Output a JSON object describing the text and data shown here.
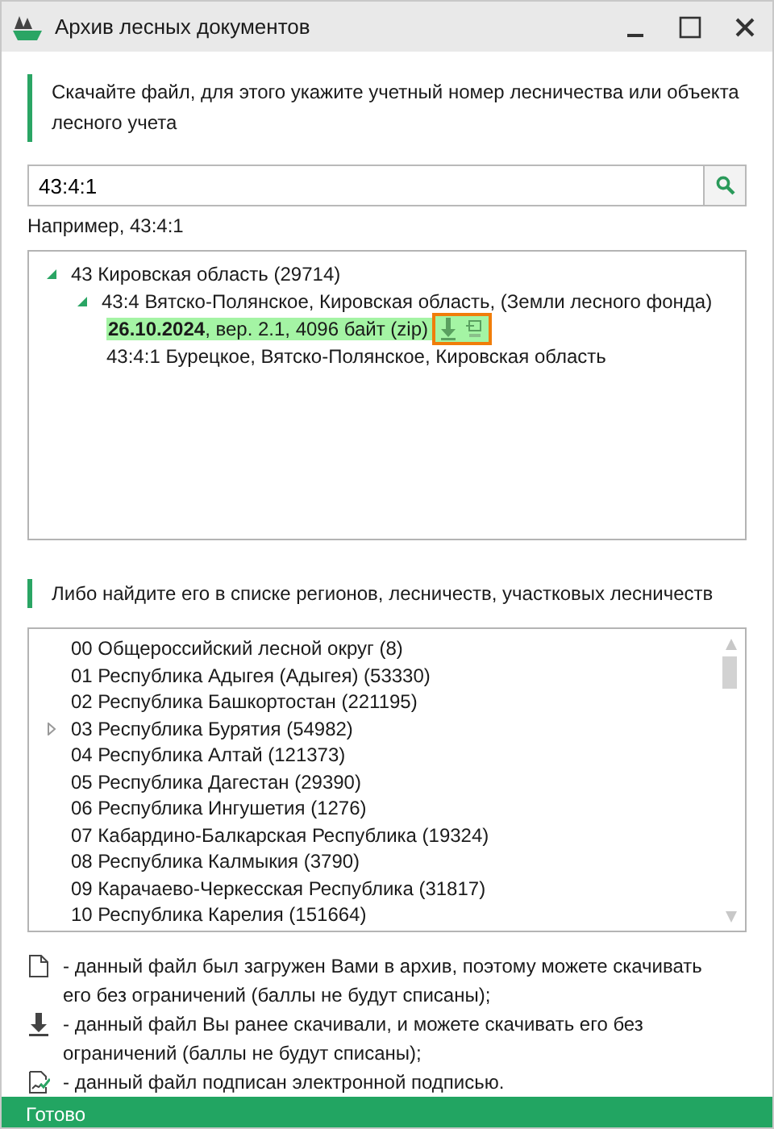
{
  "window": {
    "title": "Архив лесных документов"
  },
  "instruction": "Скачайте файл, для этого укажите учетный номер лесничества или объекта лесного учета",
  "search": {
    "value": "43:4:1"
  },
  "example": "Например, 43:4:1",
  "tree": [
    {
      "kind": "node",
      "label": "43 Кировская область (29714)",
      "expanded": true,
      "children": [
        {
          "kind": "node",
          "label": "43:4 Вятско-Полянское, Кировская область, (Земли лесного фонда)",
          "expanded": true,
          "children": [
            {
              "kind": "file",
              "label": "**26.10.2024**, вер. 2.1, 4096 байт (zip)",
              "highlighted": true,
              "focused": true
            },
            {
              "kind": "leaf",
              "label": "43:4:1 Бурецкое, Вятско-Полянское, Кировская область"
            }
          ]
        }
      ]
    }
  ],
  "list_hint": "Либо найдите его в списке регионов, лесничеств, участковых лесничеств",
  "regions": [
    {
      "label": "00 Общероссийский лесной округ (8)",
      "expandable": false
    },
    {
      "label": "01 Республика Адыгея (Адыгея) (53330)",
      "expandable": false
    },
    {
      "label": "02 Республика Башкортостан (221195)",
      "expandable": false
    },
    {
      "label": "03 Республика Бурятия (54982)",
      "expandable": true
    },
    {
      "label": "04 Республика Алтай (121373)",
      "expandable": false
    },
    {
      "label": "05 Республика Дагестан (29390)",
      "expandable": false
    },
    {
      "label": "06 Республика Ингушетия (1276)",
      "expandable": false
    },
    {
      "label": "07 Кабардино-Балкарская Республика (19324)",
      "expandable": false
    },
    {
      "label": "08 Республика Калмыкия (3790)",
      "expandable": false
    },
    {
      "label": "09 Карачаево-Черкесская Республика (31817)",
      "expandable": false
    },
    {
      "label": "10 Республика Карелия (151664)",
      "expandable": false
    }
  ],
  "legend": [
    {
      "kind": "file",
      "text": "- данный файл был загружен Вами в архив, поэтому можете скачивать его без ограничений (баллы не будут списаны);"
    },
    {
      "kind": "download",
      "text": "- данный файл Вы ранее скачивали, и можете скачивать его без ограничений (баллы не будут списаны);"
    },
    {
      "kind": "signed",
      "text": "- данный файл подписан электронной подписью."
    }
  ],
  "status_bar": "Готово"
}
